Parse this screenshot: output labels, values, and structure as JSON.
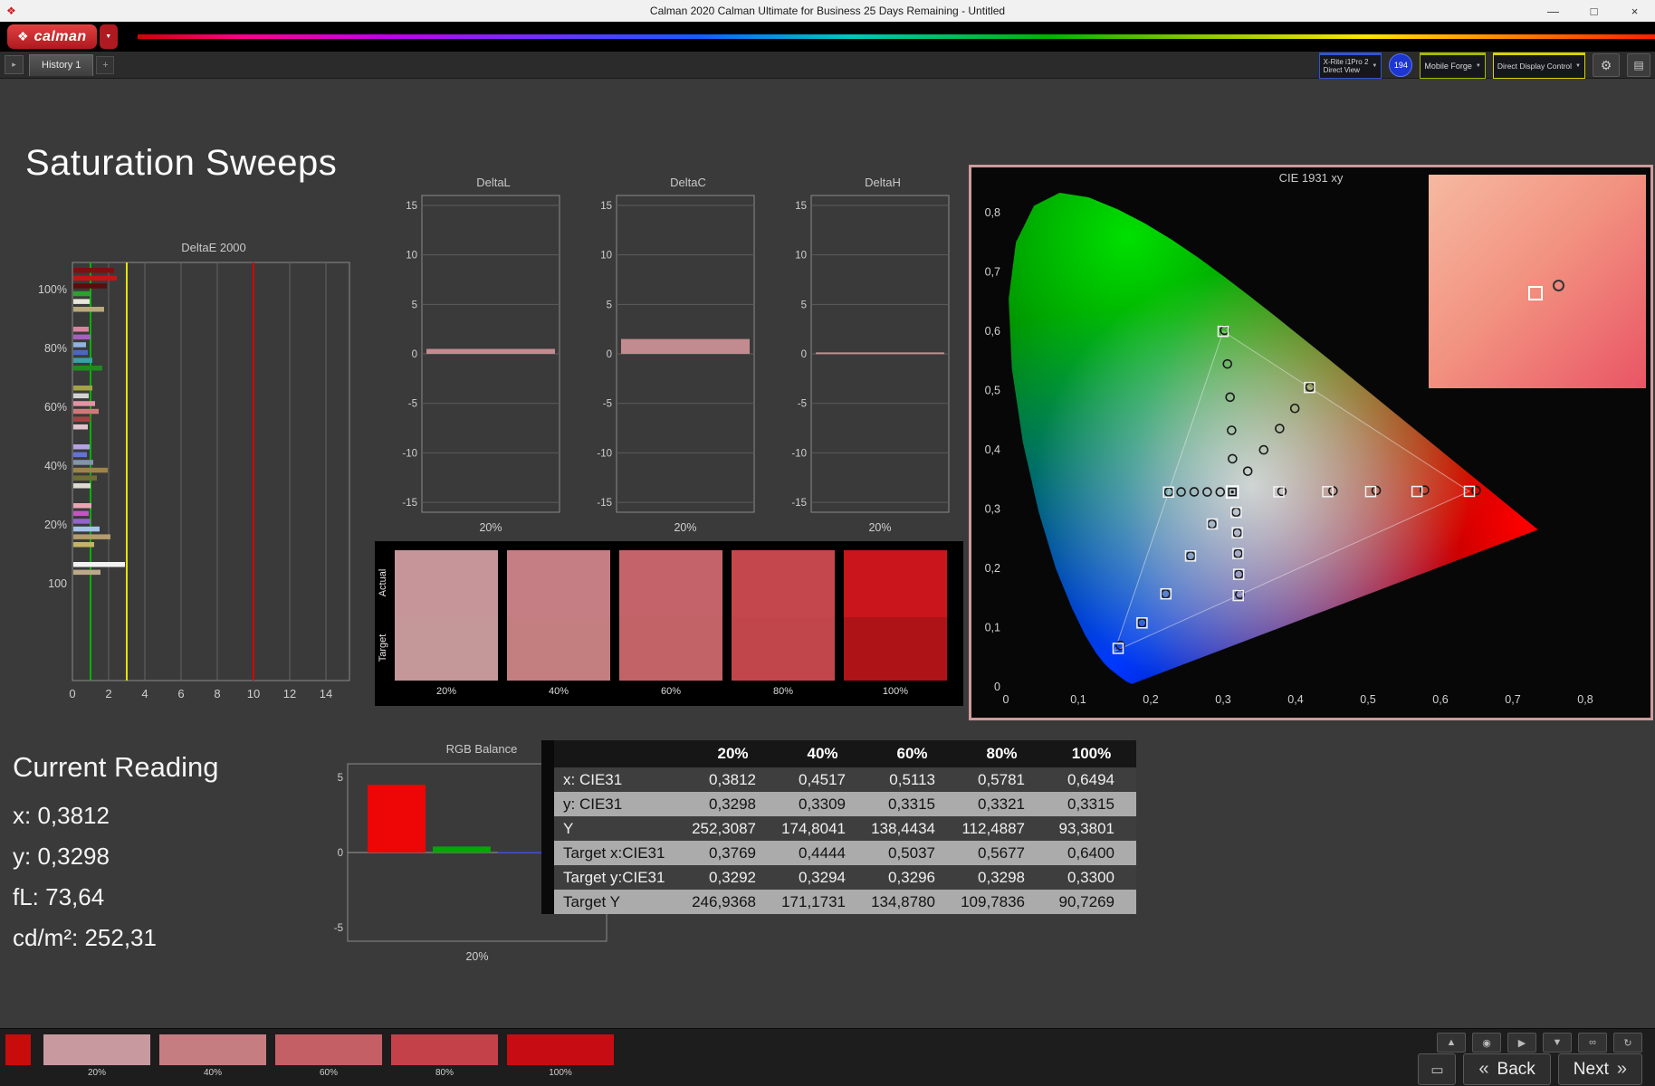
{
  "window": {
    "title": "Calman 2020 Calman Ultimate for Business 25 Days Remaining - Untitled",
    "minimize": "—",
    "maximize": "□",
    "close": "×"
  },
  "brand": {
    "logo_mark": "❖",
    "logo_text": "calman",
    "dropdown": "▼"
  },
  "tabbar": {
    "nav_arrow": "▸",
    "history_tab": "History 1",
    "add_tab": "+"
  },
  "toolbar": {
    "meter_line1": "X-Rite i1Pro 2",
    "meter_line2": "Direct View",
    "meter_accent": "#2f55d4",
    "badge": "194",
    "source_label": "Mobile Forge",
    "source_accent": "#a6b800",
    "display_label": "Direct Display Control",
    "display_accent": "#d8d200",
    "gear": "⚙",
    "panel": "▤",
    "arrow": "▼"
  },
  "page_title": "Saturation Sweeps",
  "current_reading": {
    "title": "Current Reading",
    "x": "x: 0,3812",
    "y": "y: 0,3298",
    "fl": "fL: 73,64",
    "cdm2": "cd/m²: 252,31"
  },
  "chart_data": {
    "delta_e": {
      "type": "bar",
      "title": "DeltaE 2000",
      "xticks": [
        0,
        2,
        4,
        6,
        8,
        10,
        12,
        14
      ],
      "xmax": 15.3,
      "ref_lines": [
        {
          "x": 1.0,
          "color": "#00b400"
        },
        {
          "x": 3.0,
          "color": "#e4e400"
        },
        {
          "x": 10.0,
          "color": "#d40000"
        }
      ],
      "groups": [
        {
          "label": "100%",
          "bars": [
            [
              "#7e0f0f",
              2.25
            ],
            [
              "#c41414",
              2.4
            ],
            [
              "#5e0a0a",
              1.85
            ],
            [
              "#2da02d",
              1.0
            ],
            [
              "#e6e6da",
              0.9
            ],
            [
              "#b9a97b",
              1.7
            ]
          ]
        },
        {
          "label": "80%",
          "bars": [
            [
              "#d984a0",
              0.85
            ],
            [
              "#a65fc0",
              0.95
            ],
            [
              "#8fb3e3",
              0.7
            ],
            [
              "#4a66c9",
              0.8
            ],
            [
              "#36a3a3",
              1.05
            ],
            [
              "#1f8a1f",
              1.6
            ]
          ]
        },
        {
          "label": "60%",
          "bars": [
            [
              "#a3a347",
              1.05
            ],
            [
              "#d4d4d4",
              0.85
            ],
            [
              "#e393a6",
              1.2
            ],
            [
              "#cf7a7a",
              1.4
            ],
            [
              "#a34343",
              0.95
            ],
            [
              "#e3c3cb",
              0.8
            ]
          ]
        },
        {
          "label": "40%",
          "bars": [
            [
              "#b3a3e3",
              0.9
            ],
            [
              "#6373d4",
              0.75
            ],
            [
              "#8494ac",
              1.1
            ],
            [
              "#9c8449",
              1.9
            ],
            [
              "#6f6f33",
              1.3
            ],
            [
              "#dcdcd2",
              0.95
            ]
          ]
        },
        {
          "label": "20%",
          "bars": [
            [
              "#eba4b4",
              1.0
            ],
            [
              "#c454c4",
              0.85
            ],
            [
              "#9464cc",
              0.95
            ],
            [
              "#a4c4eb",
              1.45
            ],
            [
              "#b49c6c",
              2.05
            ],
            [
              "#c4b464",
              1.15
            ]
          ]
        },
        {
          "label": "100",
          "bars": [
            [
              "#f2f2f2",
              2.85
            ],
            [
              "#bca98a",
              1.5
            ]
          ]
        }
      ]
    },
    "delta_l": {
      "type": "bar",
      "title": "DeltaL",
      "value": 0.5,
      "bar_color": "#c28b90",
      "yticks": [
        15,
        10,
        5,
        0,
        -5,
        -10,
        -15
      ],
      "xlabel": "20%"
    },
    "delta_c": {
      "type": "bar",
      "title": "DeltaC",
      "value": 1.5,
      "bar_color": "#c28b90",
      "yticks": [
        15,
        10,
        5,
        0,
        -5,
        -10,
        -15
      ],
      "xlabel": "20%"
    },
    "delta_h": {
      "type": "bar",
      "title": "DeltaH",
      "value": 0.15,
      "bar_color": "#c28b90",
      "yticks": [
        15,
        10,
        5,
        0,
        -5,
        -10,
        -15
      ],
      "xlabel": "20%"
    },
    "rgb_balance": {
      "type": "bar",
      "title": "RGB Balance",
      "yticks": [
        5,
        0,
        -5
      ],
      "xlabel": "20%",
      "bars": [
        [
          "#ee0505",
          4.5
        ],
        [
          "#00a800",
          0.4
        ],
        [
          "#2040ff",
          0.05
        ]
      ]
    },
    "cie": {
      "type": "scatter",
      "title": "CIE 1931 xy",
      "xticks": [
        "0",
        "0,1",
        "0,2",
        "0,3",
        "0,4",
        "0,5",
        "0,6",
        "0,7",
        "0,8"
      ],
      "yticks": [
        "0",
        "0,1",
        "0,2",
        "0,3",
        "0,4",
        "0,5",
        "0,6",
        "0,7",
        "0,8"
      ],
      "white_point": [
        0.3127,
        0.329
      ],
      "triangle": [
        [
          0.64,
          0.33
        ],
        [
          0.3,
          0.6
        ],
        [
          0.15,
          0.06
        ]
      ],
      "squares": [
        [
          0.3769,
          0.3292
        ],
        [
          0.4444,
          0.3294
        ],
        [
          0.5037,
          0.3296
        ],
        [
          0.5677,
          0.3298
        ],
        [
          0.64,
          0.33
        ],
        [
          0.3,
          0.6
        ],
        [
          0.4193,
          0.5053
        ],
        [
          0.2246,
          0.3287
        ],
        [
          0.318,
          0.2946
        ],
        [
          0.3196,
          0.2602
        ],
        [
          0.3205,
          0.225
        ],
        [
          0.3215,
          0.19
        ],
        [
          0.3209,
          0.1542
        ],
        [
          0.285,
          0.275
        ],
        [
          0.255,
          0.221
        ],
        [
          0.221,
          0.157
        ],
        [
          0.188,
          0.108
        ],
        [
          0.155,
          0.065
        ]
      ],
      "circles": [
        [
          0.3812,
          0.3298
        ],
        [
          0.4517,
          0.3309
        ],
        [
          0.5113,
          0.3315
        ],
        [
          0.5781,
          0.3321
        ],
        [
          0.6494,
          0.3315
        ],
        [
          0.3129,
          0.385
        ],
        [
          0.3117,
          0.433
        ],
        [
          0.3096,
          0.489
        ],
        [
          0.3059,
          0.545
        ],
        [
          0.302,
          0.602
        ],
        [
          0.334,
          0.364
        ],
        [
          0.356,
          0.4
        ],
        [
          0.378,
          0.436
        ],
        [
          0.399,
          0.47
        ],
        [
          0.42,
          0.506
        ],
        [
          0.296,
          0.329
        ],
        [
          0.278,
          0.329
        ],
        [
          0.26,
          0.3292
        ],
        [
          0.242,
          0.329
        ],
        [
          0.225,
          0.329
        ],
        [
          0.318,
          0.295
        ],
        [
          0.3195,
          0.26
        ],
        [
          0.3205,
          0.225
        ],
        [
          0.3215,
          0.19
        ],
        [
          0.323,
          0.156
        ],
        [
          0.2846,
          0.2747
        ],
        [
          0.2552,
          0.221
        ],
        [
          0.2206,
          0.157
        ],
        [
          0.188,
          0.108
        ],
        [
          0.158,
          0.07
        ]
      ],
      "locus": [
        [
          0.1741,
          0.005
        ],
        [
          0.1669,
          0.0086
        ],
        [
          0.1566,
          0.0177
        ],
        [
          0.144,
          0.0297
        ],
        [
          0.1355,
          0.0399
        ],
        [
          0.1241,
          0.0578
        ],
        [
          0.1096,
          0.0868
        ],
        [
          0.0913,
          0.1327
        ],
        [
          0.0687,
          0.2007
        ],
        [
          0.0454,
          0.295
        ],
        [
          0.0235,
          0.4127
        ],
        [
          0.0082,
          0.5384
        ],
        [
          0.0039,
          0.6548
        ],
        [
          0.0139,
          0.7502
        ],
        [
          0.0389,
          0.812
        ],
        [
          0.0743,
          0.8338
        ],
        [
          0.1142,
          0.8262
        ],
        [
          0.1547,
          0.8059
        ],
        [
          0.1929,
          0.7816
        ],
        [
          0.2296,
          0.7543
        ],
        [
          0.2658,
          0.7243
        ],
        [
          0.3016,
          0.6923
        ],
        [
          0.3373,
          0.6589
        ],
        [
          0.3731,
          0.6245
        ],
        [
          0.4087,
          0.5896
        ],
        [
          0.4441,
          0.5547
        ],
        [
          0.4788,
          0.5202
        ],
        [
          0.5125,
          0.4866
        ],
        [
          0.5448,
          0.4544
        ],
        [
          0.5752,
          0.4242
        ],
        [
          0.6029,
          0.3965
        ],
        [
          0.627,
          0.3725
        ],
        [
          0.6482,
          0.3514
        ],
        [
          0.6658,
          0.334
        ],
        [
          0.6801,
          0.3197
        ],
        [
          0.6915,
          0.3083
        ],
        [
          0.7006,
          0.2993
        ],
        [
          0.7079,
          0.292
        ],
        [
          0.714,
          0.2859
        ],
        [
          0.719,
          0.2809
        ],
        [
          0.723,
          0.277
        ],
        [
          0.7347,
          0.2653
        ]
      ],
      "inset": {
        "square_pos": [
          46,
          52
        ],
        "circle_pos": [
          57,
          49
        ]
      }
    }
  },
  "swatch_panel": {
    "row_label_actual": "Actual",
    "row_label_target": "Target",
    "columns": [
      {
        "label": "20%",
        "actual": "#c59599",
        "target": "#c49799"
      },
      {
        "label": "40%",
        "actual": "#c57f84",
        "target": "#c37e80"
      },
      {
        "label": "60%",
        "actual": "#c4646a",
        "target": "#c26367"
      },
      {
        "label": "80%",
        "actual": "#c4474e",
        "target": "#c1464b"
      },
      {
        "label": "100%",
        "actual": "#c9151b",
        "target": "#ad1317"
      }
    ]
  },
  "table": {
    "headers": [
      "",
      "20%",
      "40%",
      "60%",
      "80%",
      "100%"
    ],
    "rows": [
      {
        "label": "x: CIE31",
        "values": [
          "0,3812",
          "0,4517",
          "0,5113",
          "0,5781",
          "0,6494"
        ]
      },
      {
        "label": "y: CIE31",
        "values": [
          "0,3298",
          "0,3309",
          "0,3315",
          "0,3321",
          "0,3315"
        ]
      },
      {
        "label": "Y",
        "values": [
          "252,3087",
          "174,8041",
          "138,4434",
          "112,4887",
          "93,3801"
        ]
      },
      {
        "label": "Target x:CIE31",
        "values": [
          "0,3769",
          "0,4444",
          "0,5037",
          "0,5677",
          "0,6400"
        ]
      },
      {
        "label": "Target y:CIE31",
        "values": [
          "0,3292",
          "0,3294",
          "0,3296",
          "0,3298",
          "0,3300"
        ]
      },
      {
        "label": "Target Y",
        "values": [
          "246,9368",
          "171,1731",
          "134,8780",
          "109,7836",
          "90,7269"
        ]
      }
    ]
  },
  "footer": {
    "thumbnails": [
      {
        "label": "20%",
        "color": "#c89aa0"
      },
      {
        "label": "40%",
        "color": "#c67d82"
      },
      {
        "label": "60%",
        "color": "#c55f66"
      },
      {
        "label": "80%",
        "color": "#c4414a"
      },
      {
        "label": "100%",
        "color": "#c70d13"
      }
    ],
    "small_buttons": [
      {
        "name": "eject",
        "glyph": "▲"
      },
      {
        "name": "camera",
        "glyph": "◉"
      },
      {
        "name": "play",
        "glyph": "▶"
      },
      {
        "name": "save",
        "glyph": "▼"
      },
      {
        "name": "link",
        "glyph": "∞"
      },
      {
        "name": "sync",
        "glyph": "↻"
      }
    ],
    "display_glyph": "▭",
    "back_label": "Back",
    "next_label": "Next",
    "chev_left": "«",
    "chev_right": "»"
  }
}
